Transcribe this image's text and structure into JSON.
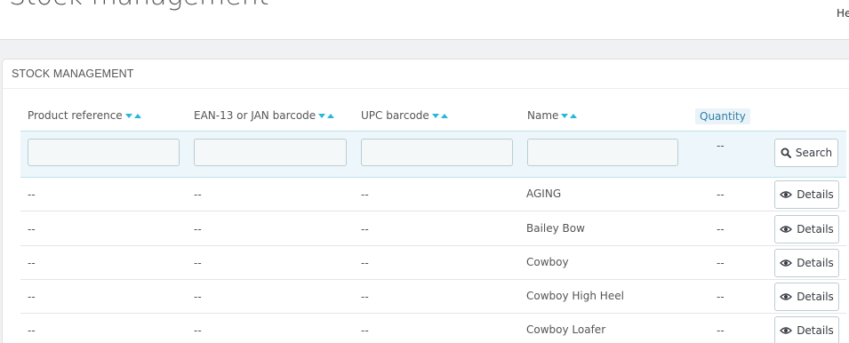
{
  "header": {
    "page_title": "Stock management",
    "right_link": "He"
  },
  "panel": {
    "heading": "STOCK MANAGEMENT"
  },
  "columns": {
    "product_reference": "Product reference",
    "ean13": "EAN-13 or JAN barcode",
    "upc": "UPC barcode",
    "name": "Name",
    "quantity": "Quantity"
  },
  "filters": {
    "product_reference": "",
    "ean13": "",
    "upc": "",
    "name": "",
    "quantity": "--",
    "search_label": "Search"
  },
  "rows": [
    {
      "reference": "--",
      "ean13": "--",
      "upc": "--",
      "name": "AGING",
      "quantity": "--",
      "action": "Details"
    },
    {
      "reference": "--",
      "ean13": "--",
      "upc": "--",
      "name": "Bailey Bow",
      "quantity": "--",
      "action": "Details"
    },
    {
      "reference": "--",
      "ean13": "--",
      "upc": "--",
      "name": "Cowboy",
      "quantity": "--",
      "action": "Details"
    },
    {
      "reference": "--",
      "ean13": "--",
      "upc": "--",
      "name": "Cowboy High Heel",
      "quantity": "--",
      "action": "Details"
    },
    {
      "reference": "--",
      "ean13": "--",
      "upc": "--",
      "name": "Cowboy Loafer",
      "quantity": "--",
      "action": "Details"
    }
  ],
  "colors": {
    "accent": "#25b9d7",
    "filter_bg": "#ecf6fb"
  },
  "icons": {
    "search": "magnifier-icon",
    "details": "eye-icon",
    "sort_desc": "caret-down-icon",
    "sort_asc": "caret-up-icon"
  }
}
